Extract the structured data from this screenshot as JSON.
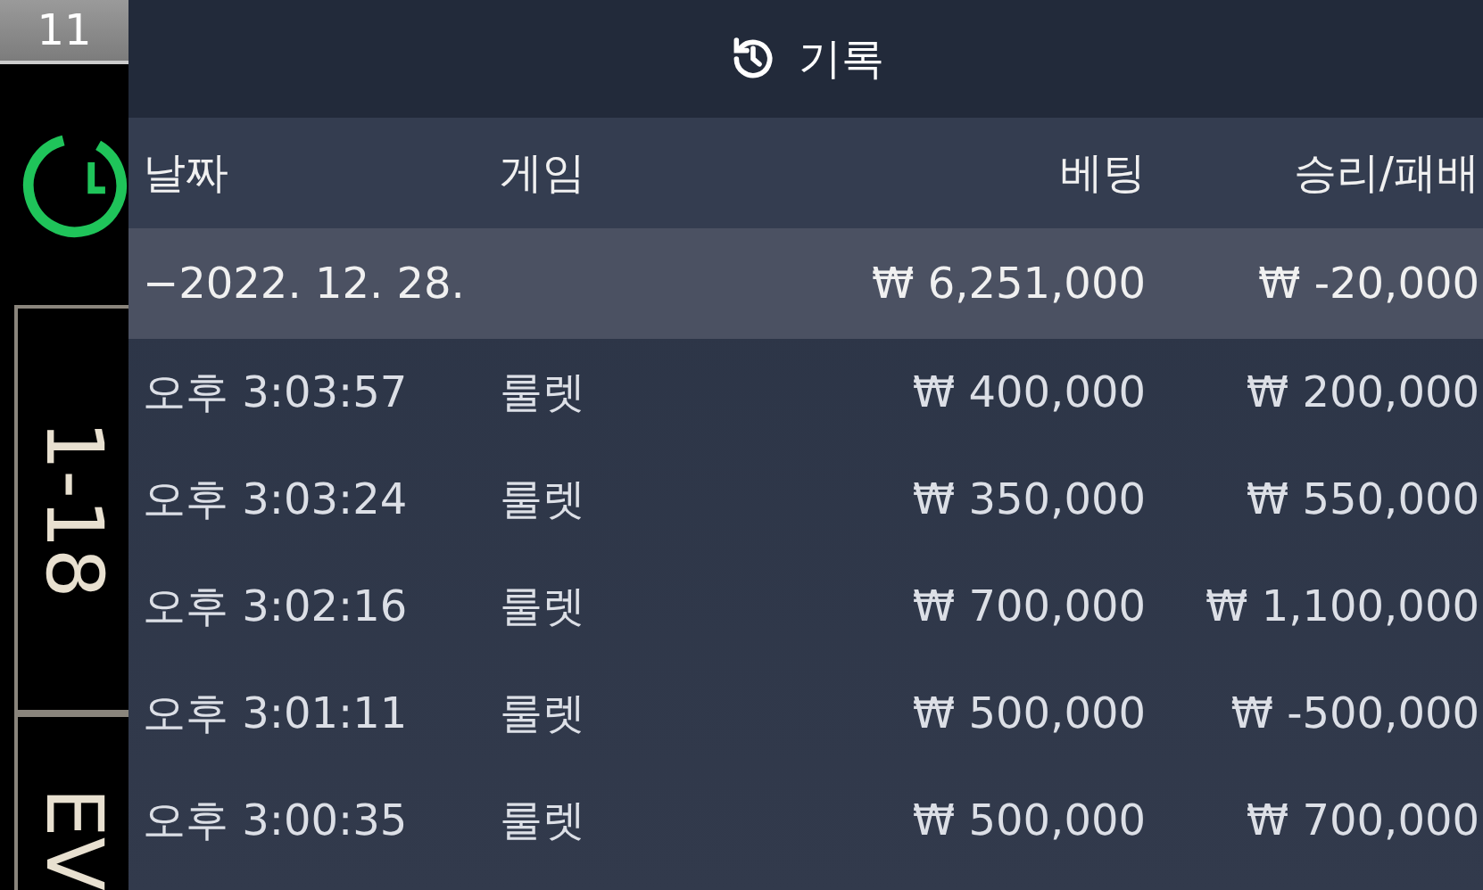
{
  "side": {
    "round": "11",
    "range": "1-18",
    "tag": "EV"
  },
  "history": {
    "title": "기록",
    "columns": [
      "날짜",
      "게임",
      "베팅",
      "승리/패배"
    ],
    "date_row": {
      "date": "−2022. 12. 28.",
      "bet": "₩ 6,251,000",
      "result": "₩ -20,000"
    },
    "rows": [
      {
        "time": "오후 3:03:57",
        "game": "룰렛",
        "bet": "₩ 400,000",
        "result": "₩ 200,000"
      },
      {
        "time": "오후 3:03:24",
        "game": "룰렛",
        "bet": "₩ 350,000",
        "result": "₩ 550,000"
      },
      {
        "time": "오후 3:02:16",
        "game": "룰렛",
        "bet": "₩ 700,000",
        "result": "₩ 1,100,000"
      },
      {
        "time": "오후 3:01:11",
        "game": "룰렛",
        "bet": "₩ 500,000",
        "result": "₩ -500,000"
      },
      {
        "time": "오후 3:00:35",
        "game": "룰렛",
        "bet": "₩ 500,000",
        "result": "₩ 700,000"
      }
    ]
  }
}
